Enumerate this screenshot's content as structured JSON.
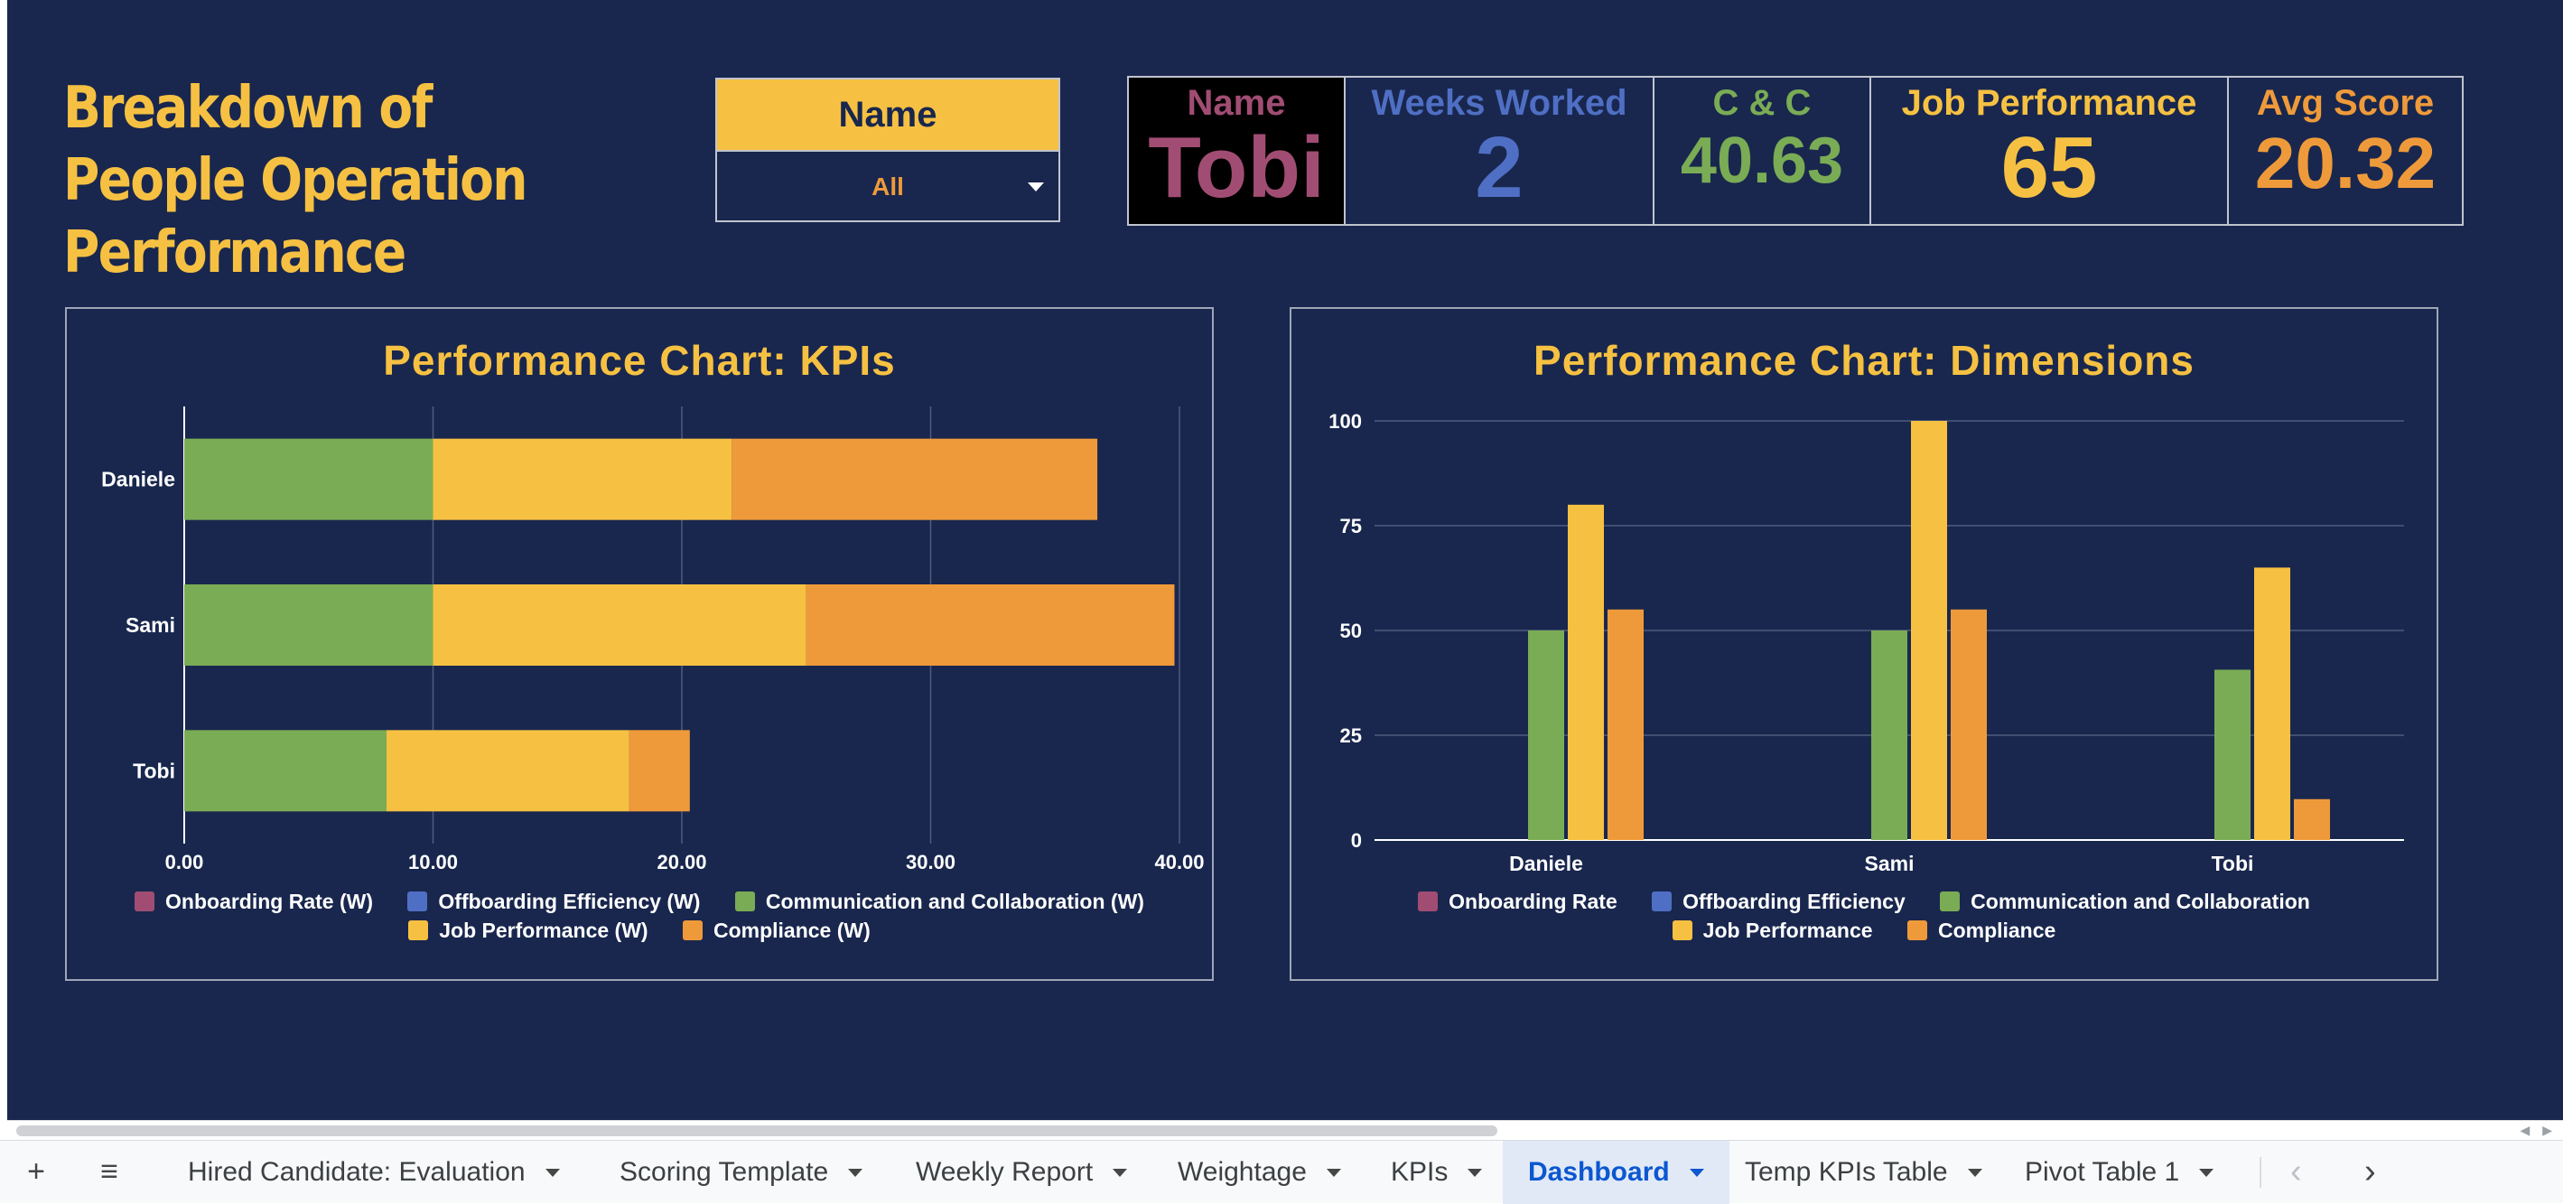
{
  "title": "Breakdown of People Operation Performance",
  "filter": {
    "label": "Name",
    "value": "All"
  },
  "kpis": [
    {
      "label": "Name",
      "value": "Tobi",
      "color": "#a14d73",
      "bg": "#000000"
    },
    {
      "label": "Weeks Worked",
      "value": "2",
      "color": "#4f6fc4",
      "bg": "#19274e"
    },
    {
      "label": "C & C",
      "value": "40.63",
      "color": "#7aac55",
      "bg": "#19274e"
    },
    {
      "label": "Job Performance",
      "value": "65",
      "color": "#f6c142",
      "bg": "#19274e"
    },
    {
      "label": "Avg Score",
      "value": "20.32",
      "color": "#ef9a3a",
      "bg": "#19274e"
    }
  ],
  "colors": {
    "background": "#19274e",
    "onboarding": "#a14d73",
    "offboarding": "#4f6fc4",
    "communication": "#7aac55",
    "job_performance": "#f6c142",
    "compliance": "#ef9a3a"
  },
  "chart_data": [
    {
      "type": "bar",
      "orientation": "horizontal",
      "stacked": true,
      "title": "Performance Chart: KPIs",
      "categories": [
        "Daniele",
        "Sami",
        "Tobi"
      ],
      "series": [
        {
          "name": "Onboarding Rate (W)",
          "color": "#a14d73",
          "values": [
            0,
            0,
            0
          ]
        },
        {
          "name": "Offboarding Efficiency (W)",
          "color": "#4f6fc4",
          "values": [
            0,
            0,
            0
          ]
        },
        {
          "name": "Communication and Collaboration (W)",
          "color": "#7aac55",
          "values": [
            10,
            10,
            8.13
          ]
        },
        {
          "name": "Job Performance (W)",
          "color": "#f6c142",
          "values": [
            12,
            15,
            9.75
          ]
        },
        {
          "name": "Compliance (W)",
          "color": "#ef9a3a",
          "values": [
            14.7,
            14.8,
            2.44
          ]
        }
      ],
      "xticks": [
        "0.00",
        "10.00",
        "20.00",
        "30.00",
        "40.00"
      ],
      "xlim": [
        0,
        40
      ],
      "grid": true,
      "legend": "bottom"
    },
    {
      "type": "bar",
      "title": "Performance Chart: Dimensions",
      "categories": [
        "Daniele",
        "Sami",
        "Tobi"
      ],
      "series": [
        {
          "name": "Onboarding Rate",
          "color": "#a14d73",
          "values": [
            0,
            0,
            0
          ]
        },
        {
          "name": "Offboarding Efficiency",
          "color": "#4f6fc4",
          "values": [
            0,
            0,
            0
          ]
        },
        {
          "name": "Communication and Collaboration",
          "color": "#7aac55",
          "values": [
            50,
            50,
            40.63
          ]
        },
        {
          "name": "Job Performance",
          "color": "#f6c142",
          "values": [
            80,
            100,
            65
          ]
        },
        {
          "name": "Compliance",
          "color": "#ef9a3a",
          "values": [
            55,
            55,
            9.75
          ]
        }
      ],
      "yticks": [
        "0",
        "25",
        "50",
        "75",
        "100"
      ],
      "ylim": [
        0,
        100
      ],
      "grid": true,
      "legend": "bottom"
    }
  ],
  "sheet_tabs": [
    {
      "label": "Hired Candidate: Evaluation",
      "active": false
    },
    {
      "label": "Scoring Template",
      "active": false
    },
    {
      "label": "Weekly Report",
      "active": false
    },
    {
      "label": "Weightage",
      "active": false
    },
    {
      "label": "KPIs",
      "active": false
    },
    {
      "label": "Dashboard",
      "active": true
    },
    {
      "label": "Temp KPIs Table",
      "active": false
    },
    {
      "label": "Pivot Table 1",
      "active": false
    }
  ],
  "icons": {
    "add_sheet": "plus-icon",
    "all_sheets": "menu-icon",
    "scroll_left": "chevron-left-icon",
    "scroll_right": "chevron-right-icon"
  }
}
